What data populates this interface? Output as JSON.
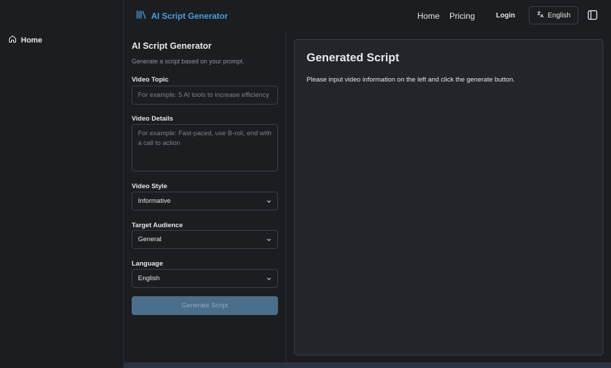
{
  "app": {
    "brand": "AI Script Generator"
  },
  "sidebar": {
    "items": [
      {
        "label": "Home",
        "icon": "home-icon"
      }
    ]
  },
  "header": {
    "nav": {
      "home": "Home",
      "pricing": "Pricing",
      "login": "Login",
      "language": "English"
    }
  },
  "form": {
    "title": "AI Script Generator",
    "subtitle": "Generate a script based on your prompt.",
    "topic": {
      "label": "Video Topic",
      "placeholder": "For example: 5 AI tools to increase efficiency",
      "value": ""
    },
    "details": {
      "label": "Video Details",
      "placeholder": "For example: Fast-paced, use B-roll, end with a call to action",
      "value": ""
    },
    "style": {
      "label": "Video Style",
      "selected": "Informative"
    },
    "audience": {
      "label": "Target Audience",
      "selected": "General"
    },
    "language": {
      "label": "Language",
      "selected": "English"
    },
    "generate_label": "Generate Script"
  },
  "output": {
    "title": "Generated Script",
    "message": "Please input video information on the left and click the generate button."
  },
  "colors": {
    "accent": "#4a9ee0",
    "background": "#1b1d21",
    "panel": "#22252a",
    "border": "#3a3f46",
    "button_disabled": "#4b6e8a"
  }
}
